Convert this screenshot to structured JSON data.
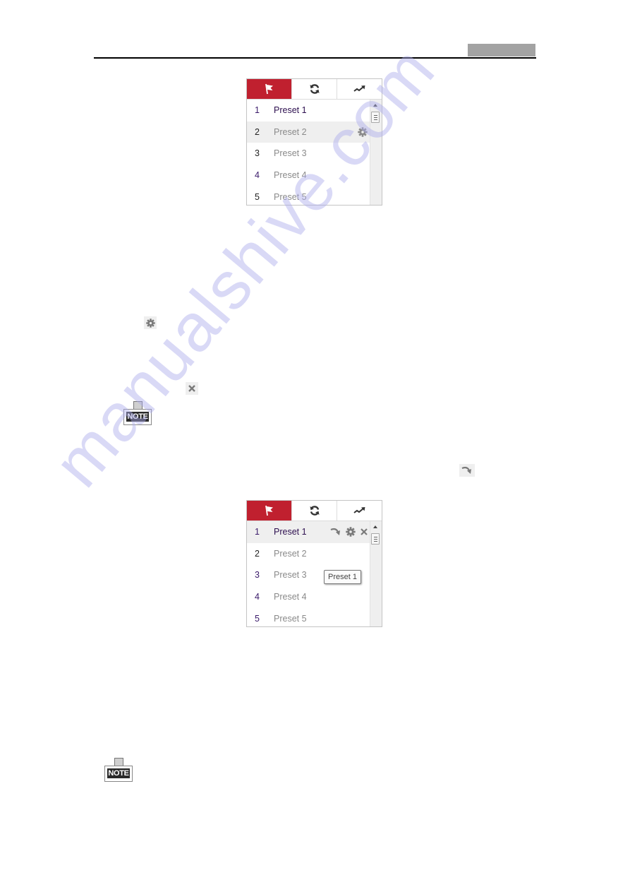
{
  "document": {
    "watermark": "manualshive.com",
    "note_label": "NOTE"
  },
  "theme": {
    "active_tab_color": "#c0202f",
    "selected_text_color": "#2d0f4f",
    "inactive_text_color": "#8a8a8a"
  },
  "panel_top": {
    "tabs": [
      {
        "name": "preset",
        "icon": "flag-icon",
        "active": true
      },
      {
        "name": "patrol",
        "icon": "refresh-cycle-icon",
        "active": false
      },
      {
        "name": "pattern",
        "icon": "trend-arrow-icon",
        "active": false
      }
    ],
    "presets": [
      {
        "number": "1",
        "label": "Preset 1"
      },
      {
        "number": "2",
        "label": "Preset 2"
      },
      {
        "number": "3",
        "label": "Preset 3"
      },
      {
        "number": "4",
        "label": "Preset 4"
      },
      {
        "number": "5",
        "label": "Preset 5"
      }
    ],
    "hovered_row": 2,
    "hover_actions": [
      "gear-icon"
    ]
  },
  "panel_bottom": {
    "tabs": [
      {
        "name": "preset",
        "icon": "flag-icon",
        "active": true
      },
      {
        "name": "patrol",
        "icon": "refresh-cycle-icon",
        "active": false
      },
      {
        "name": "pattern",
        "icon": "trend-arrow-icon",
        "active": false
      }
    ],
    "presets": [
      {
        "number": "1",
        "label": "Preset 1"
      },
      {
        "number": "2",
        "label": "Preset 2"
      },
      {
        "number": "3",
        "label": "Preset 3"
      },
      {
        "number": "4",
        "label": "Preset 4"
      },
      {
        "number": "5",
        "label": "Preset 5"
      }
    ],
    "hovered_row": 1,
    "hover_actions": [
      "call-preset-icon",
      "gear-icon",
      "close-icon"
    ],
    "tooltip": "Preset 1"
  },
  "inline_icons": [
    "gear-icon",
    "close-icon",
    "call-preset-icon"
  ]
}
